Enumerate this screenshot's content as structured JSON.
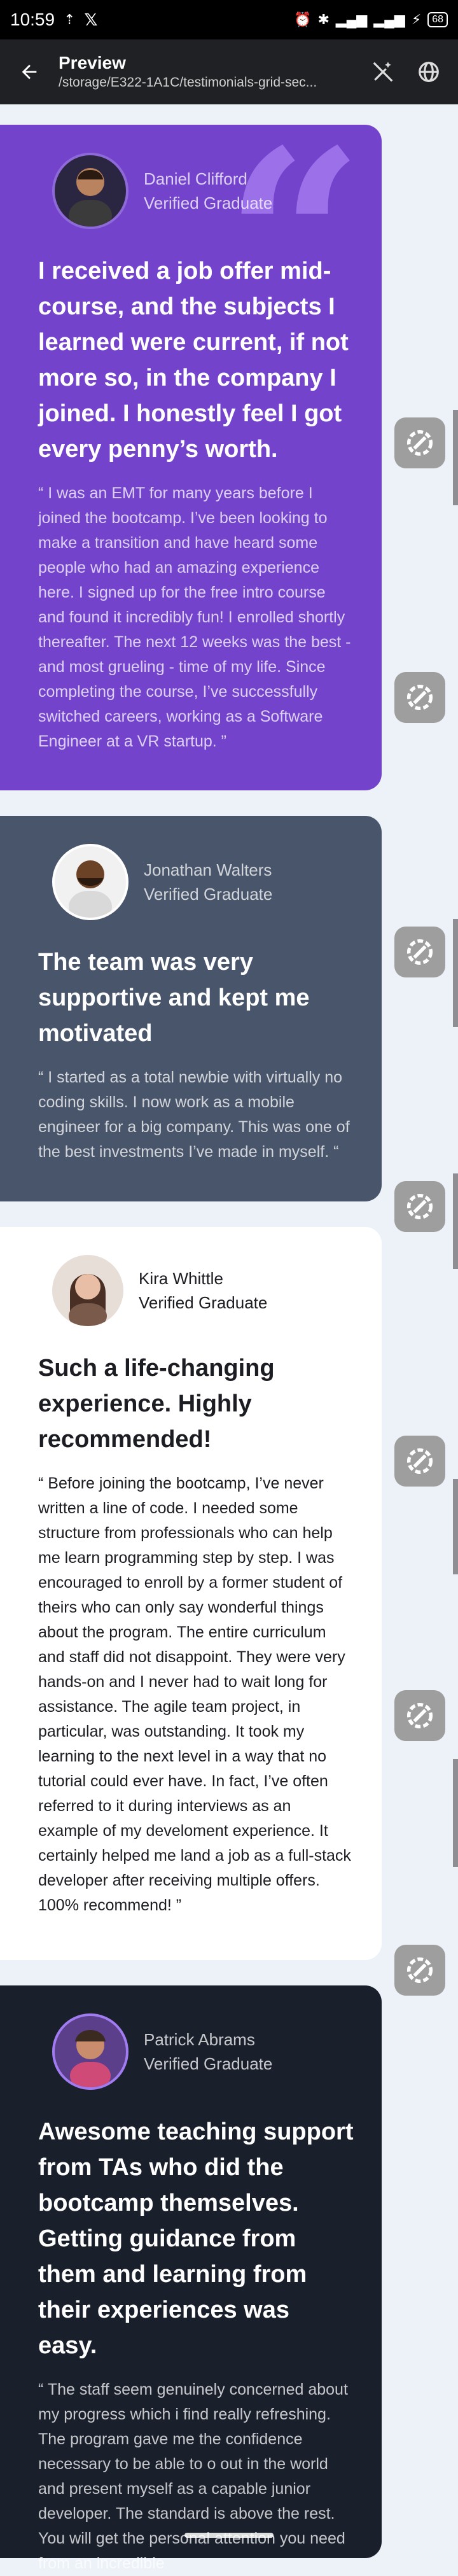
{
  "status_bar": {
    "time": "10:59",
    "battery": "68"
  },
  "app_bar": {
    "title": "Preview",
    "subtitle": "/storage/E322-1A1C/testimonials-grid-sec..."
  },
  "testimonials": [
    {
      "name": "Daniel Clifford",
      "role": "Verified Graduate",
      "headline": "I received a job offer mid-course, and the subjects I learned were current, if not more so, in the company I joined. I honestly feel I got every penny’s worth.",
      "body": "“ I was an EMT for many years before I joined the bootcamp. I’ve been looking to make a transition and have heard some people who had an amazing experience here. I signed up for the free intro course and found it incredibly fun! I enrolled shortly thereafter. The next 12 weeks was the best - and most grueling - time of my life. Since completing the course, I’ve successfully switched careers, working as a Software Engineer at a VR startup. ”",
      "color": "#7443cc"
    },
    {
      "name": "Jonathan Walters",
      "role": "Verified Graduate",
      "headline": "The team was very supportive and kept me motivated",
      "body": "“ I started as a total newbie with virtually no coding skills. I now work as a mobile engineer for a big company. This was one of the best investments I’ve made in myself. “",
      "color": "#48556a"
    },
    {
      "name": "Kira Whittle",
      "role": "Verified Graduate",
      "headline": "Such a life-changing experience. Highly recommended!",
      "body": "“ Before joining the bootcamp, I’ve never written a line of code. I needed some structure from professionals who can help me learn programming step by step. I was encouraged to enroll by a former student of theirs who can only say wonderful things about the program. The entire curriculum and staff did not disappoint. They were very hands-on and I never had to wait long for assistance. The agile team project, in particular, was outstanding. It took my learning to the next level in a way that no tutorial could ever have. In fact, I’ve often referred to it during interviews as an example of my develoment experience. It certainly helped me land a job as a full-stack developer after receiving multiple offers. 100% recommend! ”",
      "color": "#ffffff"
    },
    {
      "name": "Patrick Abrams",
      "role": "Verified Graduate",
      "headline": "Awesome teaching support from TAs who did the bootcamp themselves. Getting guidance from them and learning from their experiences was easy.",
      "body": "“ The staff seem genuinely concerned about my progress which i find really refreshing. The program gave me the confidence necessary to be able to o out in the world and present myself as a capable junior developer. The standard is above the rest. You will get the personal attention you need from an incredible",
      "color": "#1a1f2c"
    }
  ],
  "icons": {
    "back": "arrow-left-icon",
    "magic": "magic-wand-off-icon",
    "web": "globe-icon",
    "fab": "gear-wrench-icon"
  }
}
